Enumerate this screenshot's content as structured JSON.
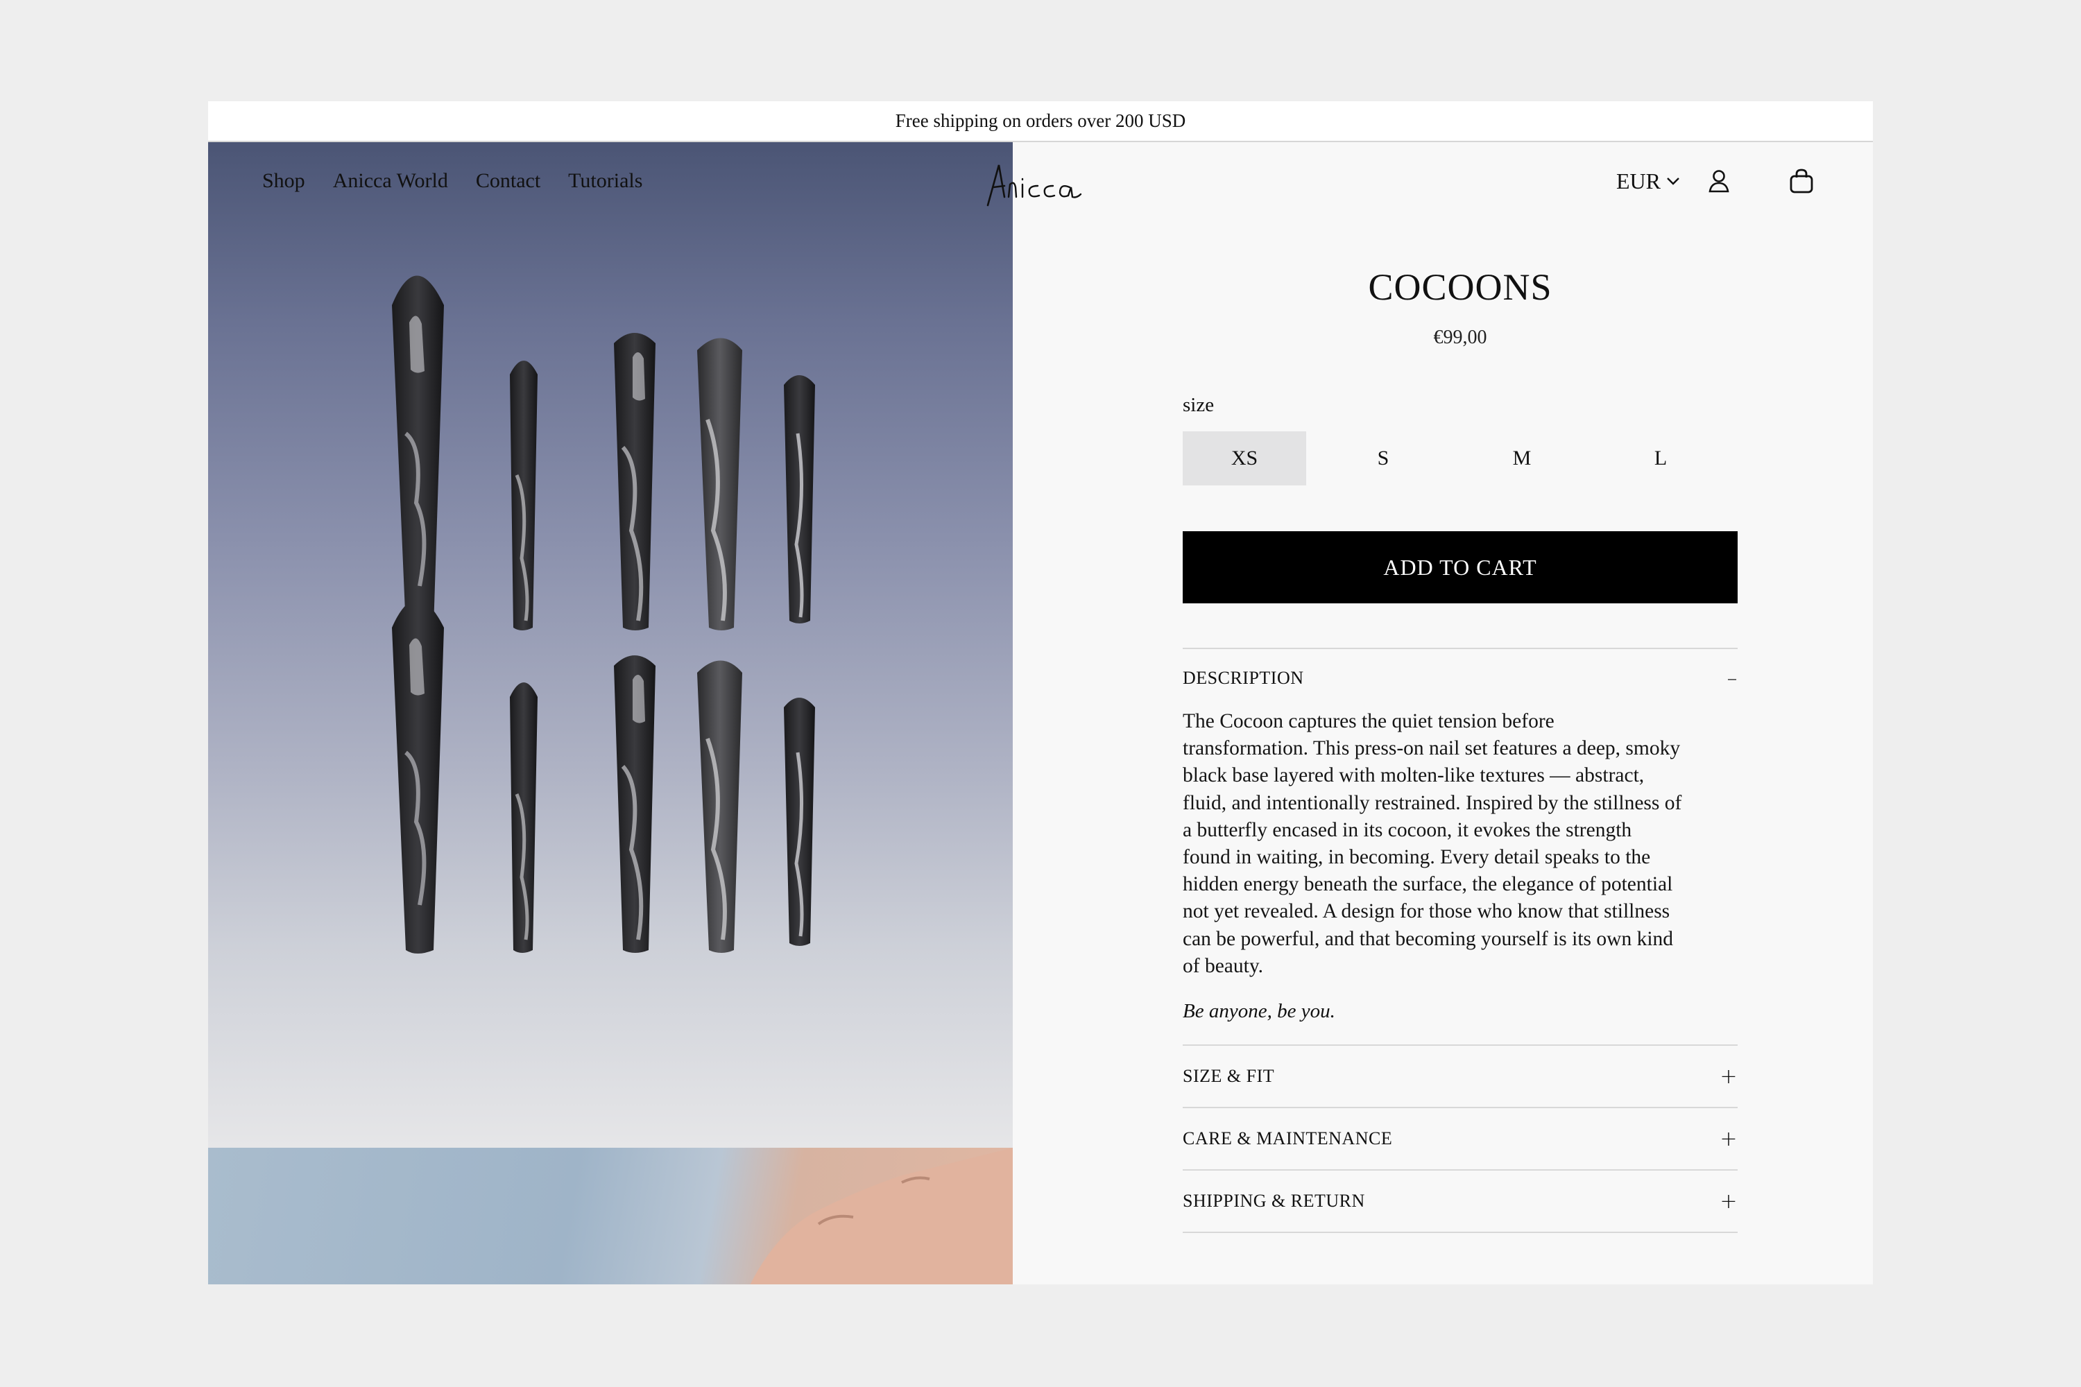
{
  "announcement": "Free shipping on orders over 200 USD",
  "nav": {
    "items": [
      {
        "label": "Shop"
      },
      {
        "label": "Anicca World"
      },
      {
        "label": "Contact"
      },
      {
        "label": "Tutorials"
      }
    ]
  },
  "brand": {
    "logo_text": "Anicca"
  },
  "header": {
    "currency": "EUR",
    "icons": [
      "chevron-down-icon",
      "account-icon",
      "cart-bag-icon"
    ]
  },
  "product": {
    "title": "COCOONS",
    "price": "€99,00",
    "size_label": "size",
    "sizes": [
      {
        "label": "XS",
        "selected": true
      },
      {
        "label": "S",
        "selected": false
      },
      {
        "label": "M",
        "selected": false
      },
      {
        "label": "L",
        "selected": false
      }
    ],
    "add_to_cart": "ADD TO CART",
    "accordions": [
      {
        "title": "DESCRIPTION",
        "open": true
      },
      {
        "title": "SIZE & FIT",
        "open": false
      },
      {
        "title": "CARE & MAINTENANCE",
        "open": false
      },
      {
        "title": "SHIPPING & RETURN",
        "open": false
      }
    ],
    "description": "The Cocoon captures the quiet tension before transformation. This press-on nail set features a deep, smoky black base layered with molten-like textures — abstract, fluid, and intentionally restrained. Inspired by the stillness of a butterfly encased in its cocoon, it evokes the strength found in waiting, in becoming. Every detail speaks to the hidden energy beneath the surface, the elegance of potential not yet revealed. A design for those who know that stillness can be powerful, and that becoming yourself is its own kind of beauty.",
    "tagline": "Be anyone, be you."
  },
  "colors": {
    "page_bg": "#eeeeee",
    "panel_bg": "#f8f8f8",
    "button_bg": "#000000",
    "selected_size_bg": "#e3e3e4"
  }
}
